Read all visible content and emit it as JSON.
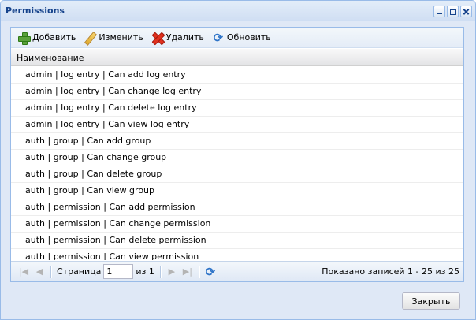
{
  "window": {
    "title": "Permissions"
  },
  "toolbar": {
    "add_label": "Добавить",
    "edit_label": "Изменить",
    "delete_label": "Удалить",
    "refresh_label": "Обновить"
  },
  "grid": {
    "column_header": "Наименование",
    "rows": [
      "admin | log entry | Can add log entry",
      "admin | log entry | Can change log entry",
      "admin | log entry | Can delete log entry",
      "admin | log entry | Can view log entry",
      "auth | group | Can add group",
      "auth | group | Can change group",
      "auth | group | Can delete group",
      "auth | group | Can view group",
      "auth | permission | Can add permission",
      "auth | permission | Can change permission",
      "auth | permission | Can delete permission",
      "auth | permission | Can view permission"
    ]
  },
  "pager": {
    "page_label": "Страница",
    "page_value": "1",
    "of_label": "из 1",
    "info": "Показано записей 1 - 25 из 25"
  },
  "footer": {
    "close_label": "Закрыть"
  }
}
